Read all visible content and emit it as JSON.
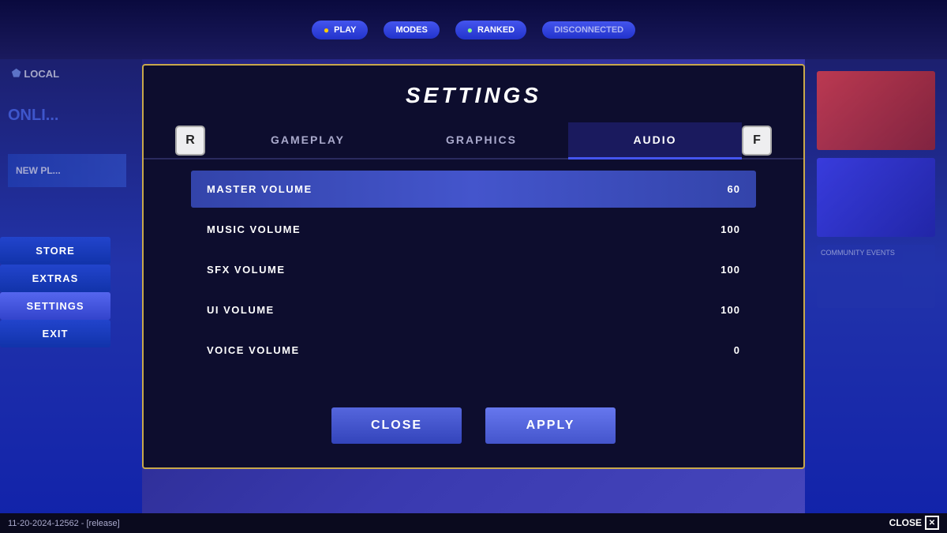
{
  "background": {
    "version_text": "11-20-2024-12562 - [release]",
    "corner_close_label": "CLOSE"
  },
  "sidebar": {
    "items": [
      {
        "label": "STORE",
        "active": false
      },
      {
        "label": "EXTRAS",
        "active": false
      },
      {
        "label": "SETTINGS",
        "active": true
      },
      {
        "label": "EXIT",
        "active": false
      }
    ]
  },
  "modal": {
    "title": "SETTINGS",
    "tabs": [
      {
        "label": "GAMEPLAY",
        "active": false
      },
      {
        "label": "GRAPHICS",
        "active": false
      },
      {
        "label": "AUDIO",
        "active": true
      }
    ],
    "left_key": "R",
    "right_key": "F",
    "settings": [
      {
        "label": "MASTER VOLUME",
        "value": "60",
        "highlighted": true
      },
      {
        "label": "MUSIC VOLUME",
        "value": "100",
        "highlighted": false
      },
      {
        "label": "SFX VOLUME",
        "value": "100",
        "highlighted": false
      },
      {
        "label": "UI VOLUME",
        "value": "100",
        "highlighted": false
      },
      {
        "label": "VOICE VOLUME",
        "value": "0",
        "highlighted": false
      }
    ],
    "footer": {
      "close_label": "CLOSE",
      "apply_label": "APPLY"
    }
  }
}
